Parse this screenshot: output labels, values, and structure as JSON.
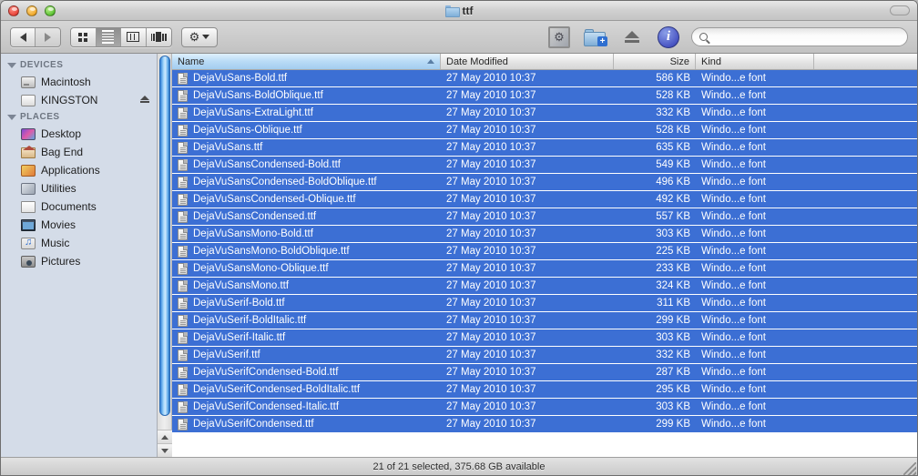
{
  "window": {
    "title": "ttf",
    "folder_icon": "folder-icon",
    "traffic_lights": [
      "close-button",
      "minimize-button",
      "maximize-button"
    ],
    "toolbar_toggle": "toolbar-toggle-button"
  },
  "toolbar": {
    "back_label": "◀",
    "forward_label": "▶",
    "view_modes": [
      {
        "name": "icon-view",
        "active": false
      },
      {
        "name": "list-view",
        "active": true
      },
      {
        "name": "column-view",
        "active": false
      },
      {
        "name": "coverflow-view",
        "active": false
      }
    ],
    "action_menu": "action-gear-menu",
    "quicklook": "quick-look-button",
    "new_folder": "new-folder-button",
    "eject": "eject-button",
    "get_info": "get-info-button",
    "info_glyph": "i"
  },
  "search": {
    "placeholder": "",
    "value": "",
    "icon": "search-icon"
  },
  "sidebar": {
    "groups": [
      {
        "label": "DEVICES",
        "items": [
          {
            "label": "Macintosh",
            "icon": "hard-disk-icon",
            "eject": false
          },
          {
            "label": "KINGSTON",
            "icon": "removable-disk-icon",
            "eject": true
          }
        ]
      },
      {
        "label": "PLACES",
        "items": [
          {
            "label": "Desktop",
            "icon": "desktop-icon",
            "eject": false
          },
          {
            "label": "Bag End",
            "icon": "home-icon",
            "eject": false
          },
          {
            "label": "Applications",
            "icon": "applications-icon",
            "eject": false
          },
          {
            "label": "Utilities",
            "icon": "utilities-icon",
            "eject": false
          },
          {
            "label": "Documents",
            "icon": "documents-icon",
            "eject": false
          },
          {
            "label": "Movies",
            "icon": "movies-icon",
            "eject": false
          },
          {
            "label": "Music",
            "icon": "music-icon",
            "eject": false
          },
          {
            "label": "Pictures",
            "icon": "pictures-icon",
            "eject": false
          }
        ]
      }
    ]
  },
  "filelist": {
    "columns": [
      {
        "key": "name",
        "label": "Name",
        "sorted": true,
        "sort_dir": "asc"
      },
      {
        "key": "date",
        "label": "Date Modified",
        "sorted": false
      },
      {
        "key": "size",
        "label": "Size",
        "sorted": false
      },
      {
        "key": "kind",
        "label": "Kind",
        "sorted": false
      }
    ],
    "selection_color": "#3c6fd4",
    "rows": [
      {
        "name": "DejaVuSans-Bold.ttf",
        "date": "27 May 2010 10:37",
        "size": "586 KB",
        "kind": "Windo...e font",
        "selected": true
      },
      {
        "name": "DejaVuSans-BoldOblique.ttf",
        "date": "27 May 2010 10:37",
        "size": "528 KB",
        "kind": "Windo...e font",
        "selected": true
      },
      {
        "name": "DejaVuSans-ExtraLight.ttf",
        "date": "27 May 2010 10:37",
        "size": "332 KB",
        "kind": "Windo...e font",
        "selected": true
      },
      {
        "name": "DejaVuSans-Oblique.ttf",
        "date": "27 May 2010 10:37",
        "size": "528 KB",
        "kind": "Windo...e font",
        "selected": true
      },
      {
        "name": "DejaVuSans.ttf",
        "date": "27 May 2010 10:37",
        "size": "635 KB",
        "kind": "Windo...e font",
        "selected": true
      },
      {
        "name": "DejaVuSansCondensed-Bold.ttf",
        "date": "27 May 2010 10:37",
        "size": "549 KB",
        "kind": "Windo...e font",
        "selected": true
      },
      {
        "name": "DejaVuSansCondensed-BoldOblique.ttf",
        "date": "27 May 2010 10:37",
        "size": "496 KB",
        "kind": "Windo...e font",
        "selected": true
      },
      {
        "name": "DejaVuSansCondensed-Oblique.ttf",
        "date": "27 May 2010 10:37",
        "size": "492 KB",
        "kind": "Windo...e font",
        "selected": true
      },
      {
        "name": "DejaVuSansCondensed.ttf",
        "date": "27 May 2010 10:37",
        "size": "557 KB",
        "kind": "Windo...e font",
        "selected": true
      },
      {
        "name": "DejaVuSansMono-Bold.ttf",
        "date": "27 May 2010 10:37",
        "size": "303 KB",
        "kind": "Windo...e font",
        "selected": true
      },
      {
        "name": "DejaVuSansMono-BoldOblique.ttf",
        "date": "27 May 2010 10:37",
        "size": "225 KB",
        "kind": "Windo...e font",
        "selected": true
      },
      {
        "name": "DejaVuSansMono-Oblique.ttf",
        "date": "27 May 2010 10:37",
        "size": "233 KB",
        "kind": "Windo...e font",
        "selected": true
      },
      {
        "name": "DejaVuSansMono.ttf",
        "date": "27 May 2010 10:37",
        "size": "324 KB",
        "kind": "Windo...e font",
        "selected": true
      },
      {
        "name": "DejaVuSerif-Bold.ttf",
        "date": "27 May 2010 10:37",
        "size": "311 KB",
        "kind": "Windo...e font",
        "selected": true
      },
      {
        "name": "DejaVuSerif-BoldItalic.ttf",
        "date": "27 May 2010 10:37",
        "size": "299 KB",
        "kind": "Windo...e font",
        "selected": true
      },
      {
        "name": "DejaVuSerif-Italic.ttf",
        "date": "27 May 2010 10:37",
        "size": "303 KB",
        "kind": "Windo...e font",
        "selected": true
      },
      {
        "name": "DejaVuSerif.ttf",
        "date": "27 May 2010 10:37",
        "size": "332 KB",
        "kind": "Windo...e font",
        "selected": true
      },
      {
        "name": "DejaVuSerifCondensed-Bold.ttf",
        "date": "27 May 2010 10:37",
        "size": "287 KB",
        "kind": "Windo...e font",
        "selected": true
      },
      {
        "name": "DejaVuSerifCondensed-BoldItalic.ttf",
        "date": "27 May 2010 10:37",
        "size": "295 KB",
        "kind": "Windo...e font",
        "selected": true
      },
      {
        "name": "DejaVuSerifCondensed-Italic.ttf",
        "date": "27 May 2010 10:37",
        "size": "303 KB",
        "kind": "Windo...e font",
        "selected": true
      },
      {
        "name": "DejaVuSerifCondensed.ttf",
        "date": "27 May 2010 10:37",
        "size": "299 KB",
        "kind": "Windo...e font",
        "selected": true
      }
    ]
  },
  "statusbar": {
    "text": "21 of 21 selected, 375.68 GB available"
  }
}
